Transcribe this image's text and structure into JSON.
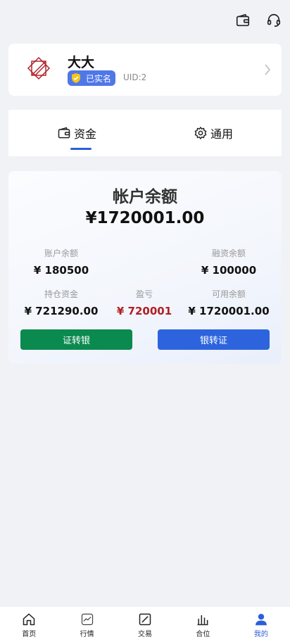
{
  "profile": {
    "name": "大大",
    "verified_label": "已实名",
    "uid": "UID:2"
  },
  "tabs": [
    {
      "label": "资金",
      "icon": "wallet-icon",
      "active": true
    },
    {
      "label": "通用",
      "icon": "gear-icon",
      "active": false
    }
  ],
  "fund": {
    "title": "帐户余额",
    "total": "¥1720001.00",
    "items": [
      {
        "label": "账户余额",
        "value": "¥ 180500"
      },
      {
        "label": "融资余额",
        "value": "¥ 100000"
      },
      {
        "label": "持仓资金",
        "value": "¥ 721290.00"
      },
      {
        "label": "盈亏",
        "value": "¥ 720001"
      },
      {
        "label": "可用余额",
        "value": "¥ 1720001.00"
      }
    ],
    "btn_out": "证转银",
    "btn_in": "银转证"
  },
  "nav": [
    {
      "label": "首页",
      "icon": "home-icon"
    },
    {
      "label": "行情",
      "icon": "market-chart-icon"
    },
    {
      "label": "交易",
      "icon": "trade-icon"
    },
    {
      "label": "合位",
      "icon": "position-bar-icon"
    },
    {
      "label": "我的",
      "icon": "user-icon",
      "active": true
    }
  ],
  "colors": {
    "accent": "#2b5fd9",
    "green_button": "#0b8a4f",
    "blue_button": "#2d64de",
    "loss_red": "#b01f24",
    "badge": "#4f77e8"
  }
}
